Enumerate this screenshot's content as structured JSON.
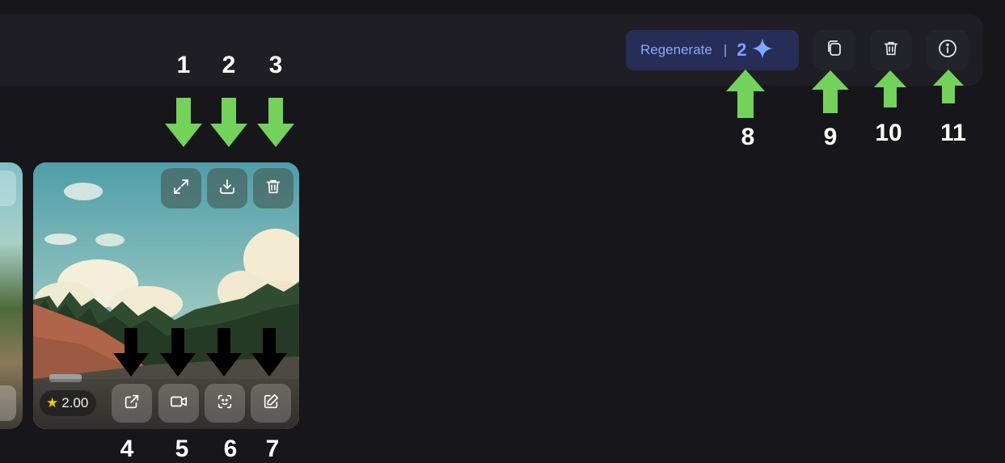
{
  "toolbar": {
    "regenerate_label": "Regenerate",
    "separator": "|",
    "regenerate_count": "2",
    "icons": [
      "sparkle-icon",
      "copy-icon",
      "trash-icon",
      "info-icon"
    ]
  },
  "image_card": {
    "rating": "2.00",
    "top_actions": [
      "expand-icon",
      "download-icon",
      "trash-icon"
    ],
    "bottom_actions": [
      "open-external-icon",
      "video-icon",
      "face-icon",
      "edit-icon"
    ]
  },
  "annotations": {
    "labels": [
      "1",
      "2",
      "3",
      "4",
      "5",
      "6",
      "7",
      "8",
      "9",
      "10",
      "11"
    ],
    "arrow_colors": {
      "green": "#72d25a",
      "black": "#000000"
    }
  },
  "colors": {
    "background": "#16161b",
    "toolbar": "#1e1e24",
    "regenerate_bg": "#262e57",
    "regenerate_text": "#8fa6f5",
    "star": "#f5c518"
  }
}
